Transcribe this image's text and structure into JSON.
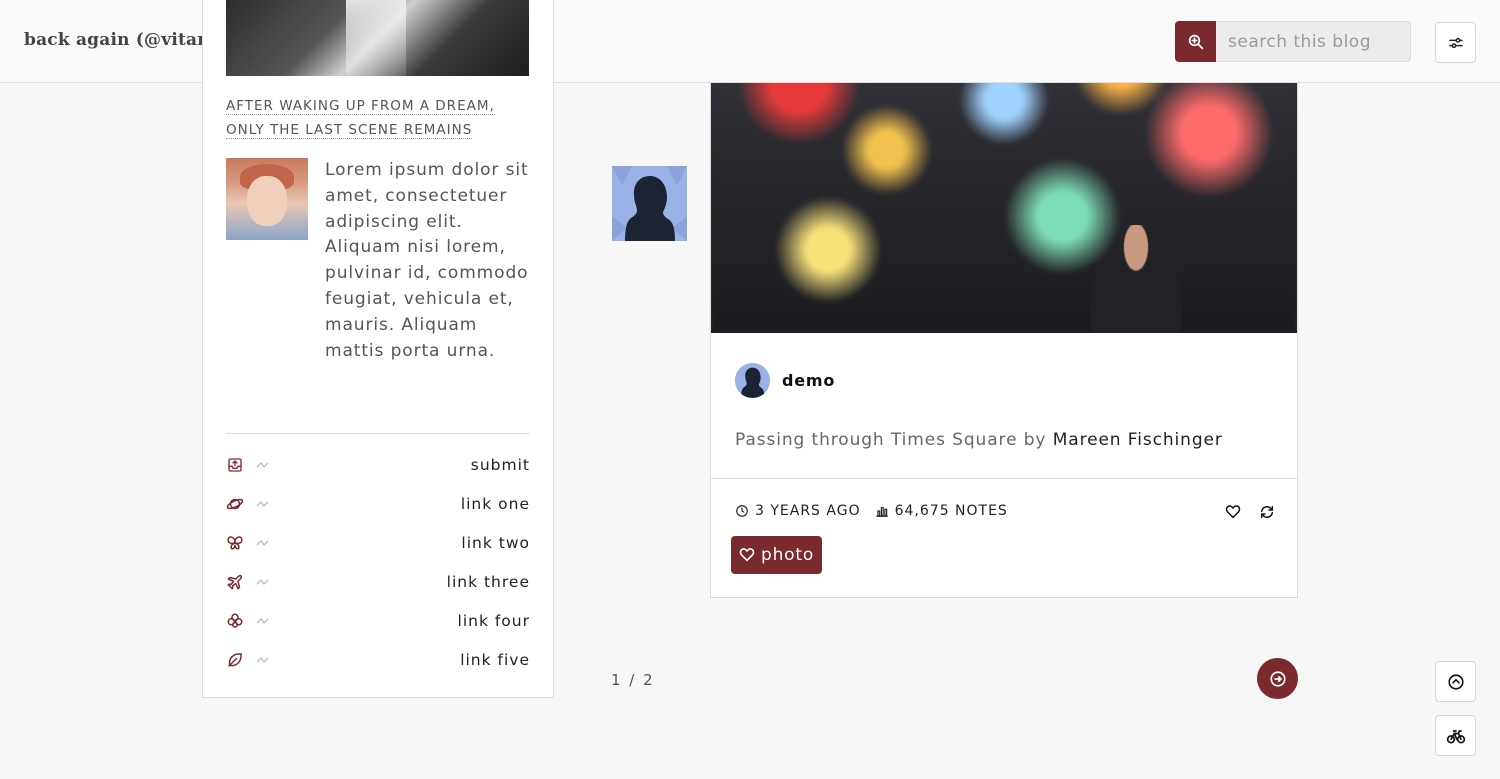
{
  "header": {
    "blog_title": "back again (@vitaminhoseok) · preview",
    "search_placeholder": "search this blog"
  },
  "sidebar": {
    "tagline": "AFTER WAKING UP FROM A DREAM, ONLY THE LAST SCENE REMAINS",
    "description": "Lorem ipsum dolor sit amet, consectetuer adipiscing elit. Aliquam nisi lorem, pulvinar id, commodo feugiat, vehicula et, mauris. Aliquam mattis porta urna.",
    "links": [
      {
        "label": "submit",
        "icon": "inbox-upload-icon"
      },
      {
        "label": "link one",
        "icon": "planet-icon"
      },
      {
        "label": "link two",
        "icon": "butterfly-icon"
      },
      {
        "label": "link three",
        "icon": "plane-icon"
      },
      {
        "label": "link four",
        "icon": "clover-icon"
      },
      {
        "label": "link five",
        "icon": "leaf-icon"
      }
    ]
  },
  "post": {
    "author": "demo",
    "caption_text": "Passing through Times Square by ",
    "caption_link": "Mareen Fischinger",
    "time": "3 YEARS AGO",
    "notes": "64,675 NOTES",
    "tag": "photo"
  },
  "pagination": {
    "label": "1 / 2"
  },
  "colors": {
    "accent": "#7a2a2e",
    "avatar_bg": "#9bb2e8"
  }
}
